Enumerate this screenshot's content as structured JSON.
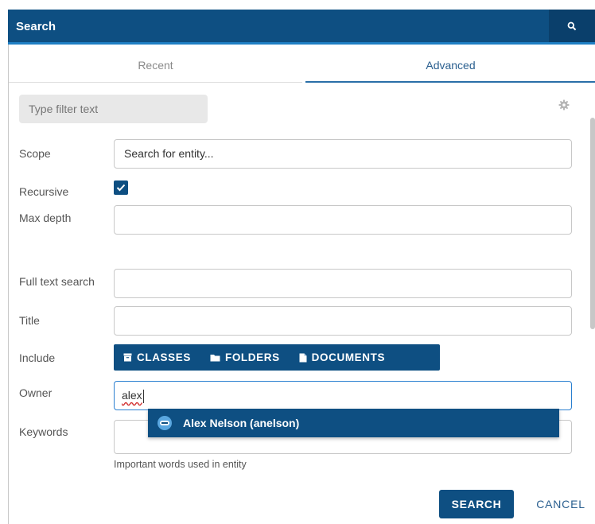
{
  "header": {
    "title": "Search",
    "search_icon": "search-icon"
  },
  "tabs": [
    {
      "label": "Recent",
      "active": false
    },
    {
      "label": "Advanced",
      "active": true
    }
  ],
  "filter": {
    "placeholder": "Type filter text",
    "value": ""
  },
  "settings_icon": "gear-icon",
  "form": {
    "scope": {
      "label": "Scope",
      "placeholder": "Search for entity..."
    },
    "recursive": {
      "label": "Recursive",
      "checked": true
    },
    "max_depth": {
      "label": "Max depth",
      "value": ""
    },
    "full_text": {
      "label": "Full text search",
      "value": ""
    },
    "title": {
      "label": "Title",
      "value": ""
    },
    "include": {
      "label": "Include",
      "options": [
        {
          "label": "CLASSES",
          "icon": "archive-icon"
        },
        {
          "label": "FOLDERS",
          "icon": "folder-icon"
        },
        {
          "label": "DOCUMENTS",
          "icon": "document-icon"
        }
      ]
    },
    "owner": {
      "label": "Owner",
      "value": "alex"
    },
    "owner_suggestion": {
      "label": "Alex Nelson (anelson)",
      "icon": "user-avatar-icon"
    },
    "keywords": {
      "label": "Keywords",
      "value": "",
      "hint": "Important words used in entity"
    }
  },
  "actions": {
    "search": "SEARCH",
    "cancel": "CANCEL"
  },
  "colors": {
    "primary": "#0e4f82",
    "accent": "#1f7fc4",
    "link": "#2a5f8f"
  }
}
